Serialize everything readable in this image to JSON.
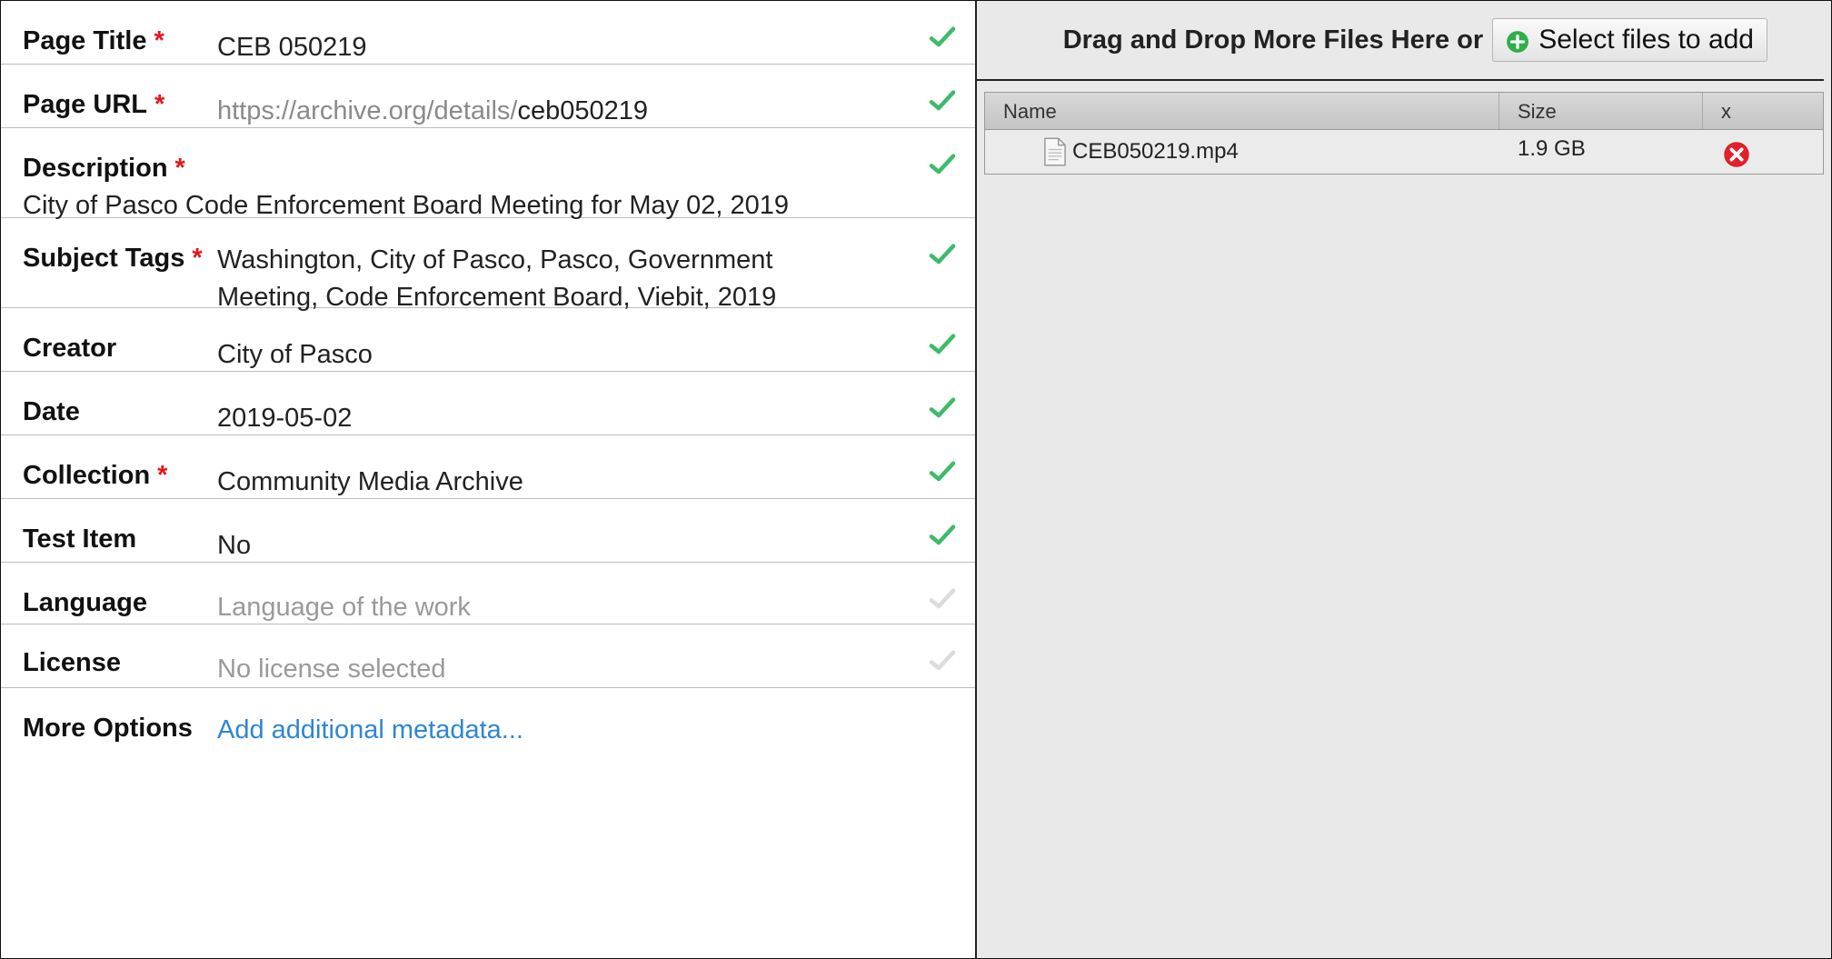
{
  "form": {
    "page_title": {
      "label": "Page Title",
      "required": "*",
      "value": "CEB 050219",
      "valid": true
    },
    "page_url": {
      "label": "Page URL",
      "required": "*",
      "prefix": "https://archive.org/details/",
      "value": "ceb050219",
      "valid": true
    },
    "description": {
      "label": "Description",
      "required": "*",
      "value": "City of Pasco Code Enforcement Board Meeting for May 02, 2019",
      "valid": true
    },
    "subject_tags": {
      "label": "Subject Tags",
      "required": "*",
      "value": "Washington, City of Pasco, Pasco, Government Meeting, Code Enforcement Board, Viebit, 2019",
      "valid": true
    },
    "creator": {
      "label": "Creator",
      "value": "City of Pasco",
      "valid": true
    },
    "date": {
      "label": "Date",
      "value": "2019-05-02",
      "valid": true
    },
    "collection": {
      "label": "Collection",
      "required": "*",
      "value": "Community Media Archive",
      "valid": true
    },
    "test_item": {
      "label": "Test Item",
      "value": "No",
      "valid": true
    },
    "language": {
      "label": "Language",
      "placeholder": "Language of the work",
      "valid": false
    },
    "license": {
      "label": "License",
      "placeholder": "No license selected",
      "valid": false
    },
    "more_options": {
      "label": "More Options",
      "link": "Add additional metadata..."
    }
  },
  "uploader": {
    "drop_text": "Drag and Drop More Files Here or",
    "select_button": "Select files to add",
    "columns": {
      "name": "Name",
      "size": "Size",
      "remove": "x"
    },
    "files": [
      {
        "name": "CEB050219.mp4",
        "size": "1.9 GB",
        "icon": "document-icon"
      }
    ]
  },
  "colors": {
    "check_valid": "#3dbb6a",
    "check_inactive": "#dcdcdc",
    "required": "#e8141a",
    "link": "#2f86d2",
    "remove": "#e0202a",
    "add": "#2fae4a"
  }
}
